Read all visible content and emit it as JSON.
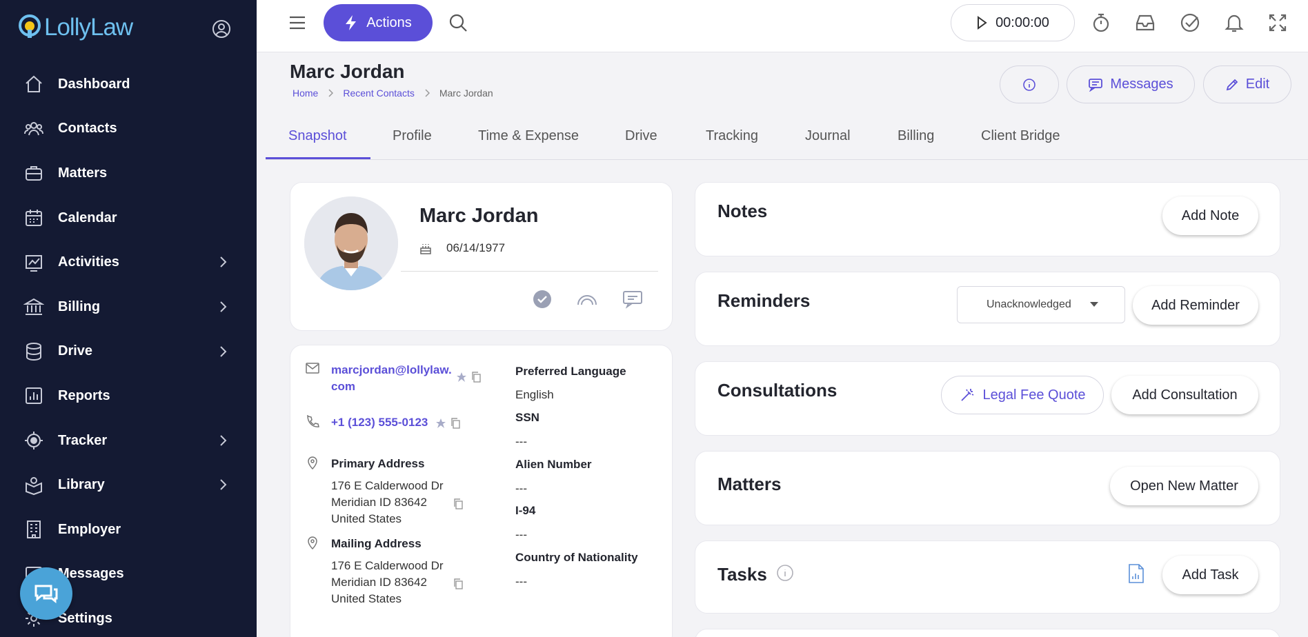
{
  "app": {
    "logo_text": "LollyLaw"
  },
  "sidebar": {
    "items": [
      {
        "label": "Dashboard",
        "icon": "home-icon",
        "chevron": false
      },
      {
        "label": "Contacts",
        "icon": "users-icon",
        "chevron": false
      },
      {
        "label": "Matters",
        "icon": "briefcase-icon",
        "chevron": false
      },
      {
        "label": "Calendar",
        "icon": "calendar-icon",
        "chevron": false
      },
      {
        "label": "Activities",
        "icon": "activity-chart-icon",
        "chevron": true
      },
      {
        "label": "Billing",
        "icon": "bank-icon",
        "chevron": true
      },
      {
        "label": "Drive",
        "icon": "database-icon",
        "chevron": true
      },
      {
        "label": "Reports",
        "icon": "report-chart-icon",
        "chevron": false
      },
      {
        "label": "Tracker",
        "icon": "target-icon",
        "chevron": true
      },
      {
        "label": "Library",
        "icon": "library-icon",
        "chevron": true
      },
      {
        "label": "Employer",
        "icon": "building-icon",
        "chevron": false
      },
      {
        "label": "Messages",
        "icon": "message-icon",
        "chevron": false
      },
      {
        "label": "Settings",
        "icon": "gear-icon",
        "chevron": false
      }
    ]
  },
  "topbar": {
    "actions_label": "Actions",
    "timer": "00:00:00"
  },
  "header": {
    "title": "Marc Jordan",
    "breadcrumb": {
      "home": "Home",
      "recent": "Recent Contacts",
      "current": "Marc Jordan"
    },
    "messages_label": "Messages",
    "edit_label": "Edit"
  },
  "tabs": [
    "Snapshot",
    "Profile",
    "Time & Expense",
    "Drive",
    "Tracking",
    "Journal",
    "Billing",
    "Client Bridge"
  ],
  "contact": {
    "name": "Marc Jordan",
    "dob": "06/14/1977",
    "email_line1": "marcjordan@lollylaw.",
    "email_line2": "com",
    "phone": "+1 (123) 555-0123",
    "primary_address_label": "Primary Address",
    "primary_address": [
      "176 E Calderwood Dr",
      "Meridian ID 83642",
      "United States"
    ],
    "mailing_address_label": "Mailing Address",
    "mailing_address": [
      "176 E Calderwood Dr",
      "Meridian ID 83642",
      "United States"
    ],
    "preferred_language_label": "Preferred Language",
    "preferred_language": "English",
    "ssn_label": "SSN",
    "ssn": "---",
    "alien_number_label": "Alien Number",
    "alien_number": "---",
    "i94_label": "I-94",
    "i94": "---",
    "country_label": "Country of Nationality",
    "country": "---"
  },
  "panels": {
    "notes": {
      "title": "Notes",
      "button": "Add Note"
    },
    "reminders": {
      "title": "Reminders",
      "filter": "Unacknowledged",
      "button": "Add Reminder"
    },
    "consultations": {
      "title": "Consultations",
      "quote_button": "Legal Fee Quote",
      "button": "Add Consultation"
    },
    "matters": {
      "title": "Matters",
      "button": "Open New Matter"
    },
    "tasks": {
      "title": "Tasks",
      "button": "Add Task"
    }
  },
  "colors": {
    "accent": "#5b4fd8",
    "sidebar": "#141a33",
    "logo": "#6ec0ef",
    "chat": "#4aa3d8"
  }
}
